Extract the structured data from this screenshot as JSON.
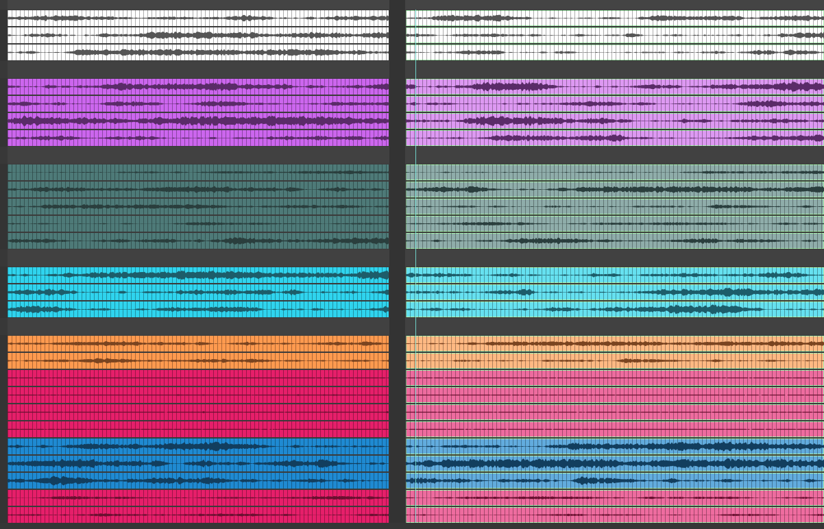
{
  "app": {
    "view": "arrange-tracks-area"
  },
  "colors": {
    "background": "#3b3b3b",
    "gap_lane": "#414141",
    "playhead": "#6fd0c8",
    "selection_outline": "#a8f0b0"
  },
  "groups": [
    {
      "name": "white",
      "left": "#ffffff",
      "right": "#ffffff",
      "wave": "#555555"
    },
    {
      "name": "purple",
      "left": "#cc66ee",
      "right": "#dd99f2",
      "wave": "#5a2b68"
    },
    {
      "name": "slate",
      "left": "#4e7a78",
      "right": "#8fadaa",
      "wave": "#2a3e3d"
    },
    {
      "name": "cyan",
      "left": "#2fd4ee",
      "right": "#66e1f0",
      "wave": "#1d5d6a"
    },
    {
      "name": "orange",
      "left": "#ff9a4f",
      "right": "#ffb983",
      "wave": "#7a4420"
    },
    {
      "name": "magenta",
      "left": "#e61f6a",
      "right": "#ee6c9f",
      "wave": "#6a1030"
    },
    {
      "name": "blue",
      "left": "#1f8ad2",
      "right": "#62acde",
      "wave": "#123e5e"
    },
    {
      "name": "magenta2",
      "left": "#e61f6a",
      "right": "#ee6c9f",
      "wave": "#6a1030"
    }
  ],
  "tracks": [
    {
      "group": "white",
      "gap": false,
      "density": 0.55
    },
    {
      "group": "white",
      "gap": false,
      "density": 0.6
    },
    {
      "group": "white",
      "gap": false,
      "density": 0.55
    },
    {
      "group": "white",
      "gap": true,
      "density": 0.7
    },
    {
      "group": "purple",
      "gap": false,
      "density": 0.8
    },
    {
      "group": "purple",
      "gap": false,
      "density": 0.6
    },
    {
      "group": "purple",
      "gap": false,
      "density": 0.85
    },
    {
      "group": "purple",
      "gap": false,
      "density": 0.6
    },
    {
      "group": "purple",
      "gap": true,
      "density": 0.6
    },
    {
      "group": "slate",
      "gap": false,
      "density": 0.3
    },
    {
      "group": "slate",
      "gap": false,
      "density": 0.55
    },
    {
      "group": "slate",
      "gap": false,
      "density": 0.4
    },
    {
      "group": "slate",
      "gap": false,
      "density": 0.3
    },
    {
      "group": "slate",
      "gap": false,
      "density": 0.6
    },
    {
      "group": "slate",
      "gap": true,
      "density": 0.4
    },
    {
      "group": "cyan",
      "gap": false,
      "density": 0.75
    },
    {
      "group": "cyan",
      "gap": false,
      "density": 0.75
    },
    {
      "group": "cyan",
      "gap": false,
      "density": 0.75
    },
    {
      "group": "cyan",
      "gap": true,
      "density": 0.5
    },
    {
      "group": "orange",
      "gap": false,
      "density": 0.4
    },
    {
      "group": "orange",
      "gap": false,
      "density": 0.45
    },
    {
      "group": "magenta",
      "gap": false,
      "density": 0.12
    },
    {
      "group": "magenta",
      "gap": false,
      "density": 0.15
    },
    {
      "group": "magenta",
      "gap": false,
      "density": 0.18
    },
    {
      "group": "magenta",
      "gap": false,
      "density": 0.12
    },
    {
      "group": "blue",
      "gap": false,
      "density": 0.8
    },
    {
      "group": "blue",
      "gap": false,
      "density": 0.8
    },
    {
      "group": "blue",
      "gap": false,
      "density": 0.8
    },
    {
      "group": "magenta2",
      "gap": false,
      "density": 0.3
    },
    {
      "group": "magenta2",
      "gap": false,
      "density": 0.25
    }
  ]
}
